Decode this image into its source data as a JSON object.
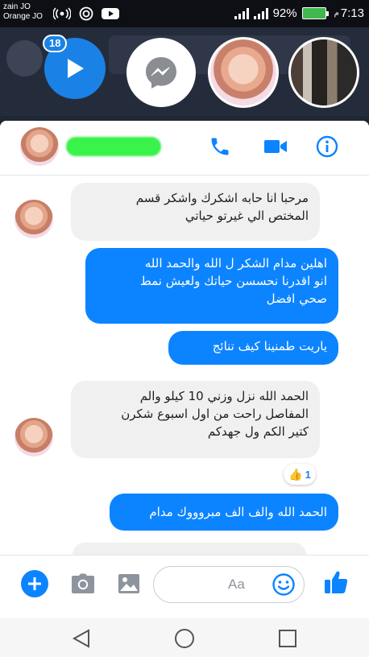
{
  "status_bar": {
    "carrier_1": "zain JO",
    "carrier_2": "Orange JO",
    "battery": "92%",
    "time_prefix": "م",
    "time": "7:13"
  },
  "chat_heads": {
    "unread_badge": "18",
    "items": [
      "play-head",
      "messenger-head",
      "girl-avatar-head",
      "group-photo-head"
    ]
  },
  "conversation_header": {
    "contact_name_redacted": true,
    "icons": [
      "phone-icon",
      "video-call-icon",
      "info-icon"
    ],
    "accent_color": "#0c84ff"
  },
  "messages": [
    {
      "direction": "incoming",
      "text": "مرحبا  انا حابه اشكرك  واشكر قسم\nالمختص الي غيرتو حياتي"
    },
    {
      "direction": "outgoing",
      "text": "اهلين مدام  الشكر ل الله والحمد الله\nانو اقدرنا نحسسن حياتك ولعيش نمط\nصحي افضل"
    },
    {
      "direction": "outgoing",
      "text": "ياريت طمنينا كيف تنائج"
    },
    {
      "direction": "incoming",
      "text": "الحمد الله نزل وزني 10 كيلو  والم\nالمفاصل راحت من اول  اسبوع شكرن\nكتير الكم ول جهدكم"
    },
    {
      "direction": "outgoing",
      "text": "الحمد الله والف الف مبروووك مدام"
    }
  ],
  "reaction": {
    "emoji": "👍",
    "count": "1"
  },
  "composer": {
    "placeholder": "Aa",
    "icons": [
      "plus-icon",
      "camera-icon",
      "image-icon",
      "emoji-icon",
      "thumbs-up-icon"
    ]
  },
  "nav_bar": {
    "buttons": [
      "back-icon",
      "home-icon",
      "recents-icon"
    ]
  }
}
